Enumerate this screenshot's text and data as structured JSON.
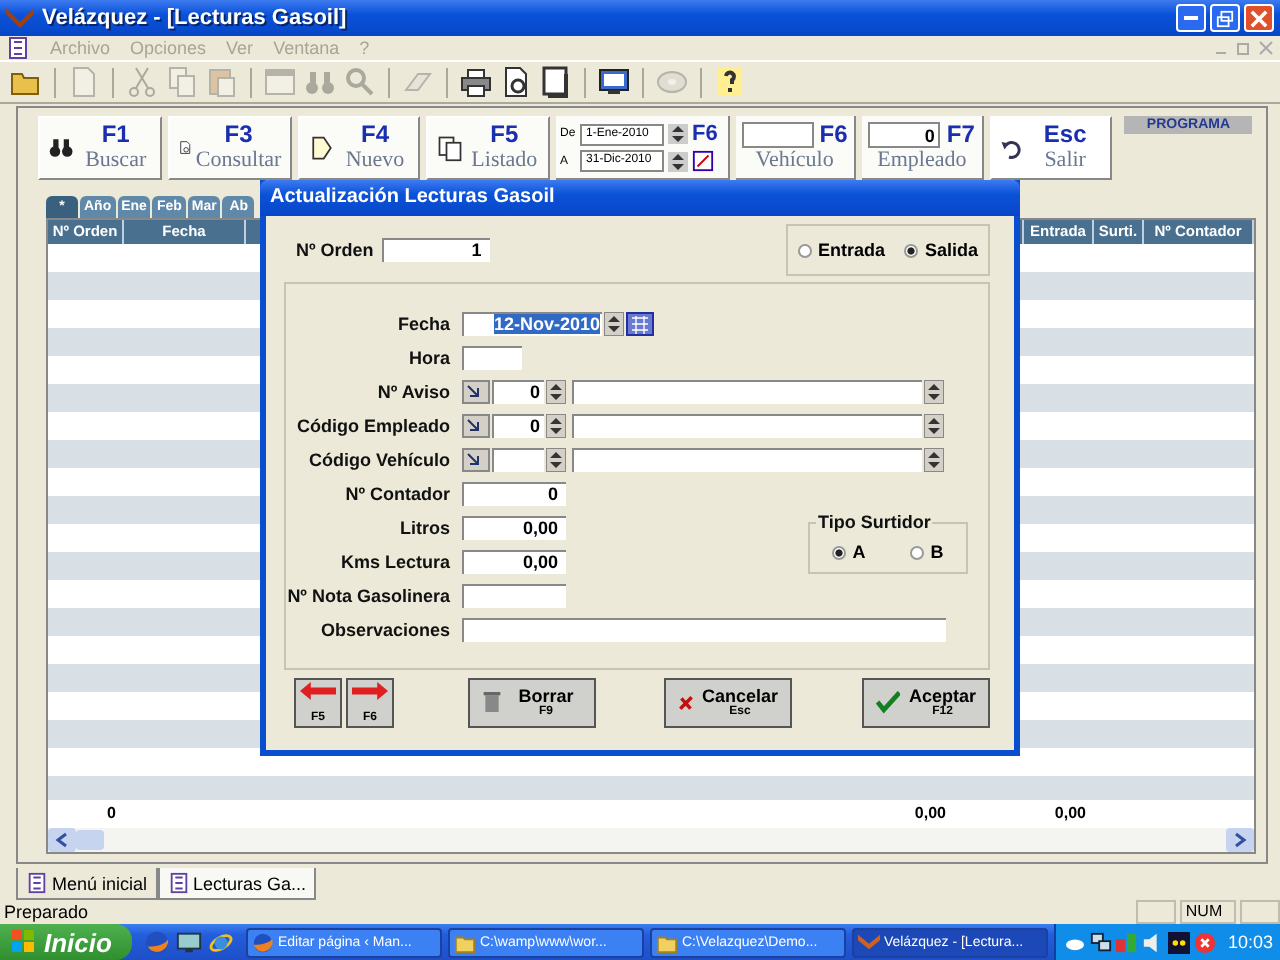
{
  "window": {
    "title": "Velázquez - [Lecturas Gasoil]"
  },
  "menu": [
    {
      "label": "Archivo",
      "disabled": true
    },
    {
      "label": "Opciones",
      "disabled": true
    },
    {
      "label": "Ver",
      "disabled": true
    },
    {
      "label": "Ventana",
      "disabled": true
    },
    {
      "label": "?",
      "disabled": true
    }
  ],
  "toolbar": [
    {
      "disabled": false
    },
    {
      "disabled": true
    },
    {
      "disabled": true
    },
    {
      "disabled": true
    },
    {
      "disabled": true
    },
    {
      "disabled": true
    },
    {
      "disabled": true
    },
    {
      "disabled": true
    },
    {
      "disabled": true
    },
    {
      "disabled": false
    },
    {
      "disabled": false
    },
    {
      "disabled": false
    },
    {
      "disabled": false
    },
    {
      "disabled": true
    },
    {
      "disabled": false
    }
  ],
  "function_buttons": [
    {
      "key": "F1",
      "label": "Buscar"
    },
    {
      "key": "F3",
      "label": "Consultar"
    },
    {
      "key": "F4",
      "label": "Nuevo"
    },
    {
      "key": "F5",
      "label": "Listado"
    }
  ],
  "date_range": {
    "from_label": "De",
    "from": "1-Ene-2010",
    "to_label": "A",
    "to": "31-Dic-2010",
    "key": "F6"
  },
  "filters": [
    {
      "key": "F6",
      "label": "Vehículo"
    },
    {
      "key": "F7",
      "label": "Empleado",
      "value": "0"
    }
  ],
  "exit_button": {
    "key": "Esc",
    "label": "Salir"
  },
  "program_label": "PROGRAMA",
  "period_tabs": [
    {
      "label": "*",
      "selected": true
    },
    {
      "label": "Año",
      "selected": false
    },
    {
      "label": "Ene",
      "selected": false
    },
    {
      "label": "Feb",
      "selected": false
    },
    {
      "label": "Mar",
      "selected": false
    },
    {
      "label": "Ab",
      "selected": false
    }
  ],
  "table": {
    "columns": [
      "Nº Orden",
      "Fecha",
      "Entrada",
      "Surti.",
      "Nº Contador"
    ],
    "totals": [
      "0",
      "0,00",
      "0,00"
    ]
  },
  "dialog": {
    "title": "Actualización Lecturas Gasoil",
    "order": {
      "label": "Nº Orden",
      "value": "1"
    },
    "movement": [
      {
        "label": "Entrada",
        "selected": false
      },
      {
        "label": "Salida",
        "selected": true
      }
    ],
    "fields": [
      {
        "kind": "date",
        "label": "Fecha",
        "value": "12-Nov-2010",
        "highlighted": true
      },
      {
        "kind": "short",
        "label": "Hora"
      },
      {
        "kind": "lookup",
        "label": "Nº Aviso",
        "value": "0"
      },
      {
        "kind": "lookup",
        "label": "Código Empleado",
        "value": "0"
      },
      {
        "kind": "lookup",
        "label": "Código Vehículo"
      },
      {
        "kind": "number",
        "label": "Nº Contador",
        "value": "0"
      },
      {
        "kind": "number",
        "label": "Litros",
        "value": "0,00"
      },
      {
        "kind": "number",
        "label": "Kms Lectura",
        "value": "0,00"
      },
      {
        "kind": "number",
        "label": "Nº Nota Gasolinera"
      },
      {
        "kind": "wide",
        "label": "Observaciones"
      }
    ],
    "pump_type": {
      "label": "Tipo Surtidor",
      "options": [
        {
          "label": "A",
          "selected": true
        },
        {
          "label": "B",
          "selected": false
        }
      ]
    },
    "nav_buttons": [
      {
        "kind": "previous",
        "key": "F5"
      },
      {
        "kind": "next",
        "key": "F6"
      }
    ],
    "buttons": [
      {
        "kind": "delete",
        "label": "Borrar",
        "key": "F9"
      },
      {
        "kind": "cancel",
        "label": "Cancelar",
        "key": "Esc"
      },
      {
        "kind": "accept",
        "label": "Aceptar",
        "key": "F12"
      }
    ]
  },
  "document_tabs": [
    {
      "label": "Menú inicial",
      "selected": false
    },
    {
      "label": "Lecturas Ga...",
      "selected": true
    }
  ],
  "status_bar": {
    "message": "Preparado",
    "indicator": "NUM"
  },
  "taskbar": {
    "start": "Inicio",
    "tasks": [
      {
        "label": "Editar página ‹ Man...",
        "kind": "browser",
        "selected": false
      },
      {
        "label": "C:\\wamp\\www\\wor...",
        "kind": "folder",
        "selected": false
      },
      {
        "label": "C:\\Velazquez\\Demo...",
        "kind": "folder",
        "selected": false
      },
      {
        "label": "Velázquez - [Lectura...",
        "kind": "app",
        "selected": true
      }
    ],
    "clock": "10:03"
  }
}
